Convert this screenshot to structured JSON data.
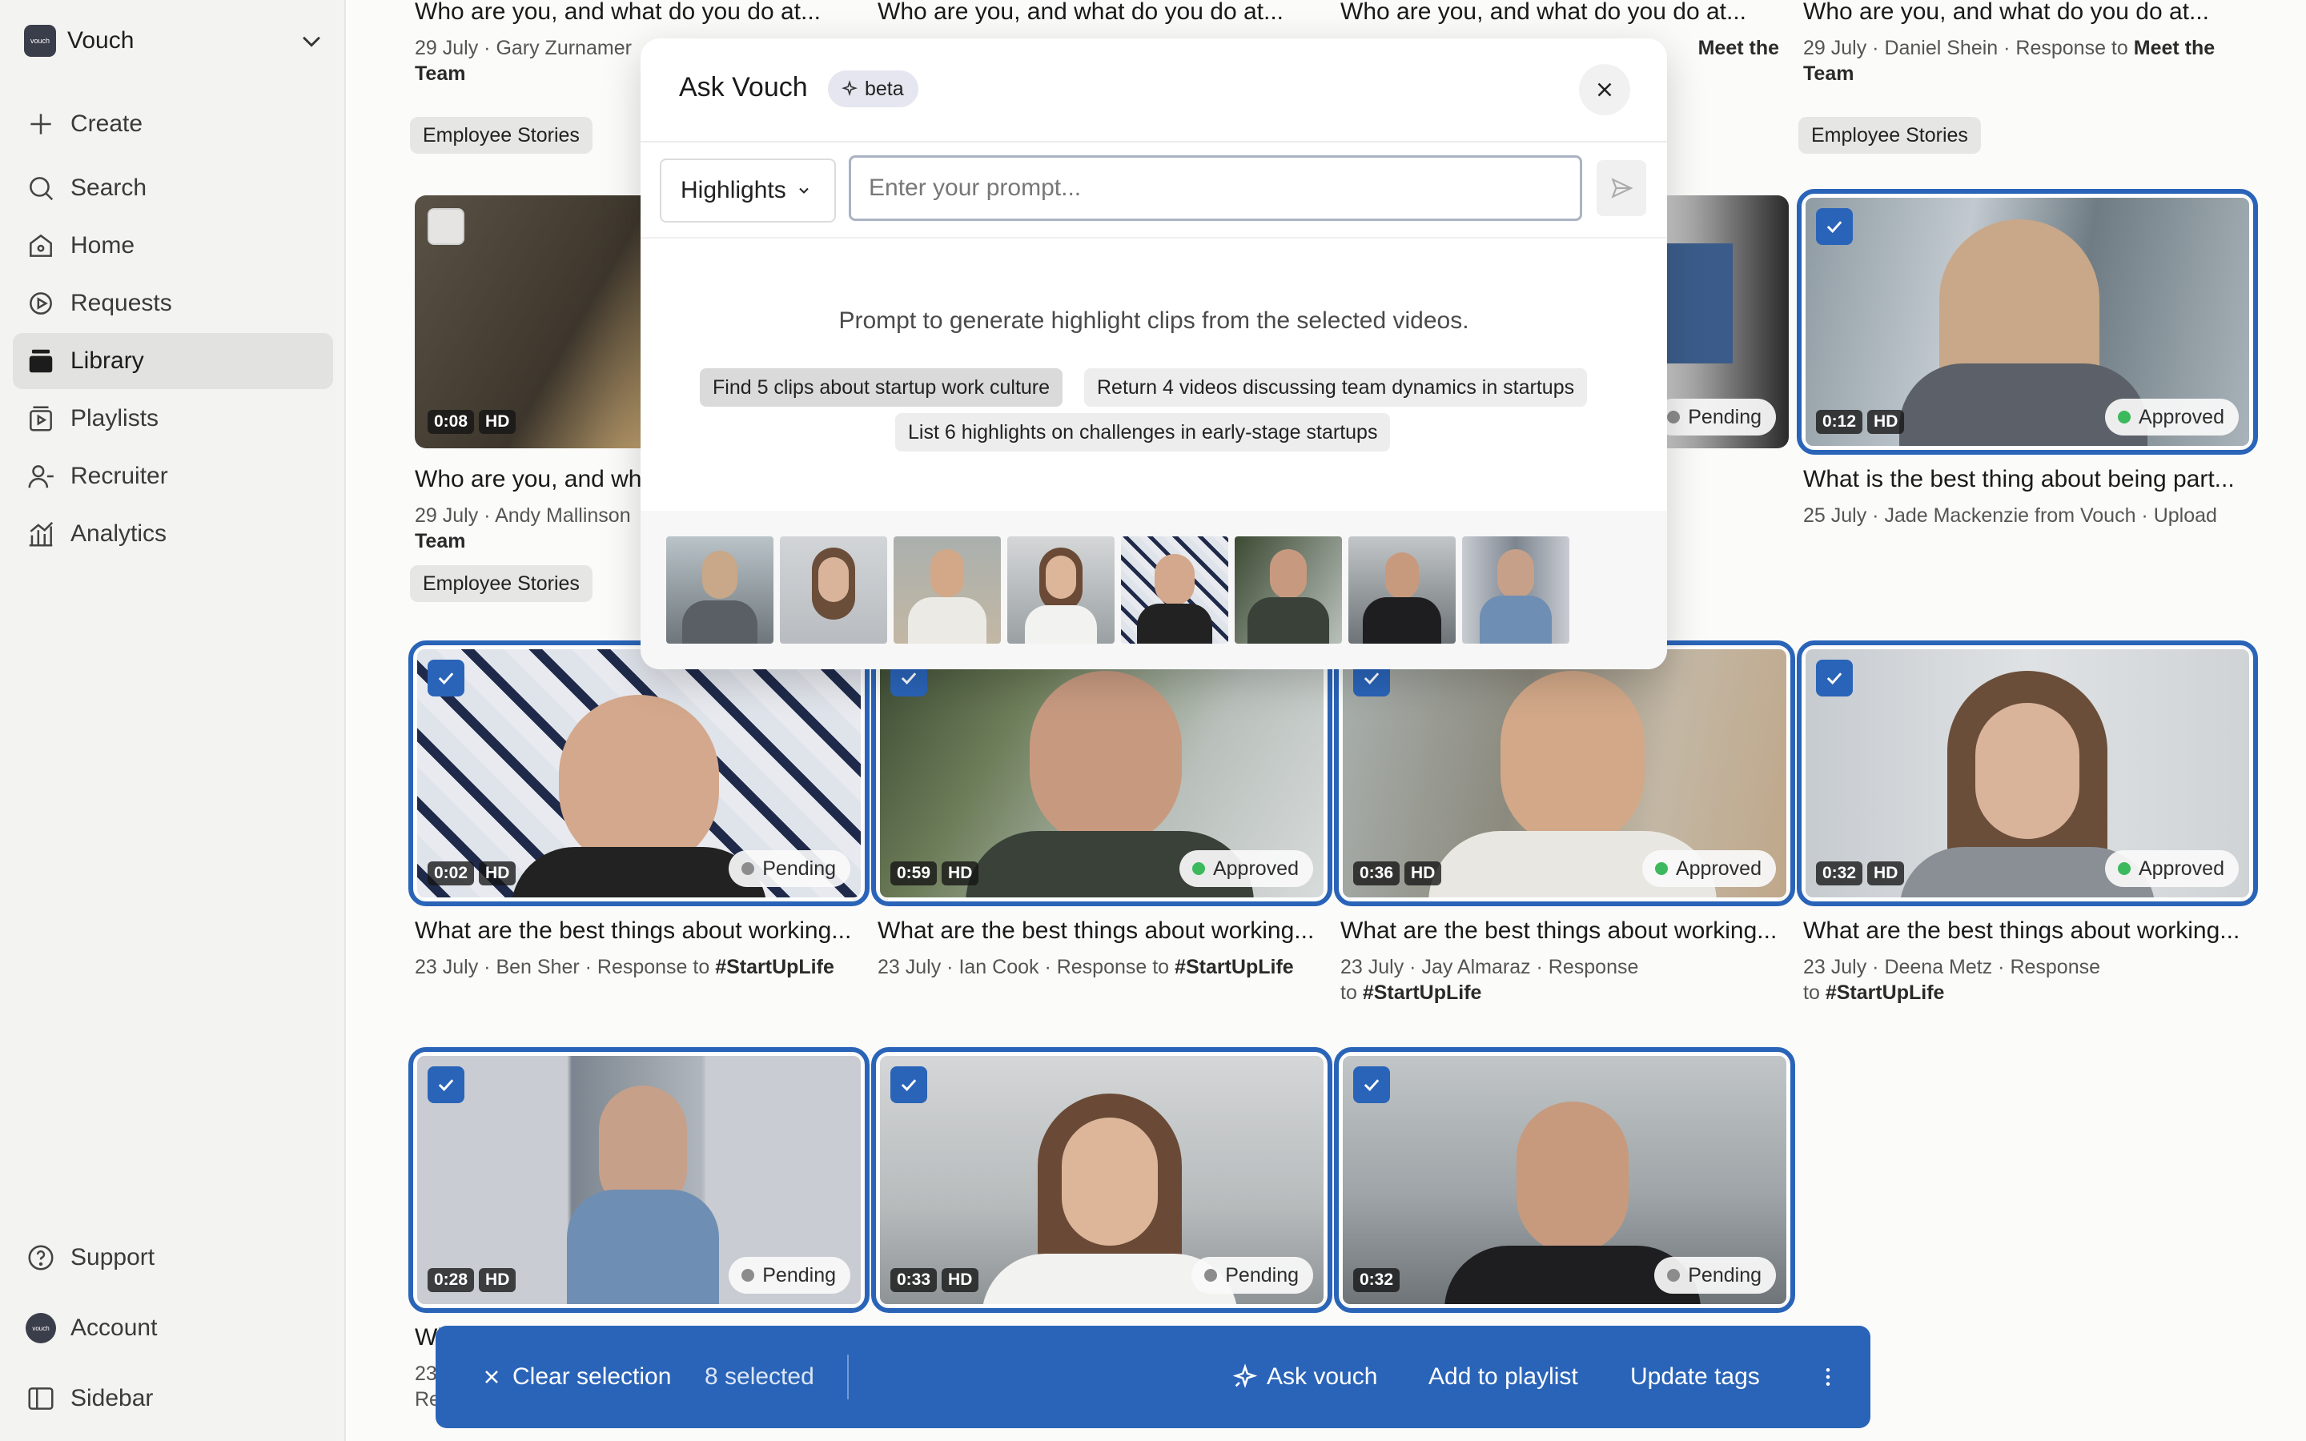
{
  "sidebar": {
    "workspace": {
      "logo": "vouch",
      "name": "Vouch"
    },
    "items": [
      {
        "label": "Create",
        "icon": "plus-icon"
      },
      {
        "label": "Search",
        "icon": "search-icon"
      },
      {
        "label": "Home",
        "icon": "home-icon"
      },
      {
        "label": "Requests",
        "icon": "requests-icon"
      },
      {
        "label": "Library",
        "icon": "library-icon",
        "active": true
      },
      {
        "label": "Playlists",
        "icon": "playlists-icon"
      },
      {
        "label": "Recruiter",
        "icon": "recruiter-icon"
      },
      {
        "label": "Analytics",
        "icon": "analytics-icon"
      }
    ],
    "bottom": [
      {
        "label": "Support",
        "icon": "help-icon"
      },
      {
        "label": "Account",
        "icon": "account-avatar"
      },
      {
        "label": "Sidebar",
        "icon": "sidebar-icon"
      }
    ]
  },
  "grid": {
    "row1": [
      {
        "title": "Who are you, and what do you do at...",
        "date": "29 July",
        "meta": "Gary Zurnamer",
        "meta_line2": "Team",
        "tag": "Employee Stories"
      },
      {
        "title": "Who are you, and what do you do at..."
      },
      {
        "title": "Who are you, and what do you do at...",
        "meta_bold": "Meet the"
      },
      {
        "title": "Who are you, and what do you do at...",
        "date": "29 July",
        "meta": "Daniel Shein · Response to",
        "meta_bold": "Meet the",
        "meta_line2": "Team",
        "tag": "Employee Stories"
      }
    ],
    "row2": [
      {
        "duration": "0:08",
        "quality": "HD",
        "title": "Who are you, and wh",
        "date": "29 July",
        "meta": "Andy Mallinson",
        "meta_line2": "Team",
        "tag": "Employee Stories"
      },
      {
        "status": "Pending"
      },
      {
        "duration": "0:12",
        "quality": "HD",
        "status": "Approved",
        "title": "What is the best thing about being part...",
        "date": "25 July",
        "meta": "Jade Mackenzie from Vouch · Upload"
      }
    ],
    "row3": [
      {
        "duration": "0:02",
        "quality": "HD",
        "status": "Pending",
        "title": "What are the best things about working...",
        "date": "23 July",
        "meta": "Ben Sher · Response to",
        "meta_bold": "#StartUpLife"
      },
      {
        "duration": "0:59",
        "quality": "HD",
        "status": "Approved",
        "title": "What are the best things about working...",
        "date": "23 July",
        "meta": "Ian Cook · Response to",
        "meta_bold": "#StartUpLife"
      },
      {
        "duration": "0:36",
        "quality": "HD",
        "status": "Approved",
        "title": "What are the best things about working...",
        "date": "23 July",
        "meta": "Jay Almaraz · Response",
        "meta_line2": "to",
        "meta_bold": "#StartUpLife"
      },
      {
        "duration": "0:32",
        "quality": "HD",
        "status": "Approved",
        "title": "What are the best things about working...",
        "date": "23 July",
        "meta": "Deena Metz · Response",
        "meta_line2": "to",
        "meta_bold": "#StartUpLife"
      }
    ],
    "row4": [
      {
        "duration": "0:28",
        "quality": "HD",
        "status": "Pending",
        "title": "Wh",
        "date": "23",
        "meta_line2": "Re"
      },
      {
        "duration": "0:33",
        "quality": "HD",
        "status": "Pending"
      },
      {
        "duration": "0:32",
        "status": "Pending"
      }
    ]
  },
  "modal": {
    "title": "Ask Vouch",
    "badge": "beta",
    "mode": "Highlights",
    "placeholder": "Enter your prompt...",
    "hint": "Prompt to generate highlight clips from the selected videos.",
    "suggestions": [
      "Find 5 clips about startup work culture",
      "Return 4 videos discussing team dynamics in startups",
      "List 6 highlights on challenges in early-stage startups"
    ],
    "thumbnail_count": 8
  },
  "action_bar": {
    "clear": "Clear selection",
    "count": "8 selected",
    "ask": "Ask vouch",
    "add": "Add to playlist",
    "tags": "Update tags"
  },
  "colors": {
    "accent": "#2a64b8",
    "approved": "#3cb95c",
    "pending": "#8c8c8c",
    "sidebar_bg": "#f3f3f2"
  }
}
